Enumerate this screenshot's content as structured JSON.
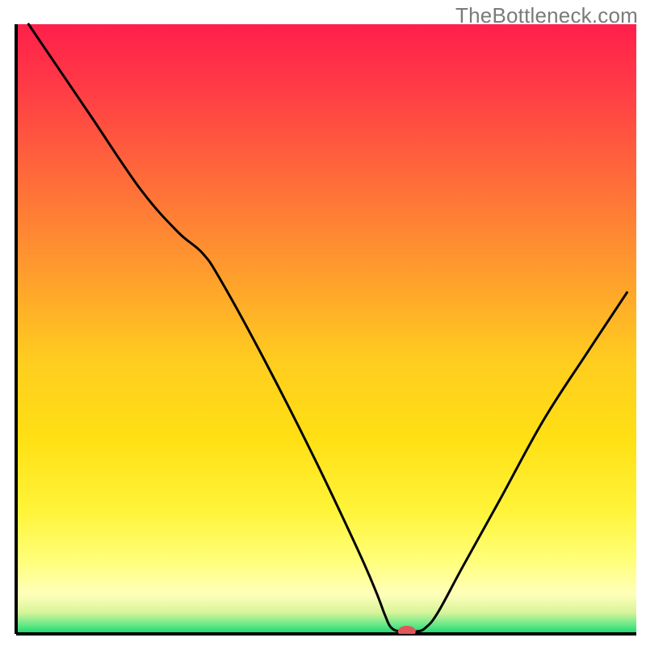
{
  "watermark": "TheBottleneck.com",
  "chart_data": {
    "type": "line",
    "title": "",
    "xlabel": "",
    "ylabel": "",
    "xlim": [
      0,
      100
    ],
    "ylim": [
      0,
      100
    ],
    "background_gradient": {
      "stops": [
        {
          "offset": 0.0,
          "color": "#ff1f4b"
        },
        {
          "offset": 0.1,
          "color": "#ff3a46"
        },
        {
          "offset": 0.25,
          "color": "#ff6a3a"
        },
        {
          "offset": 0.4,
          "color": "#ff9a2e"
        },
        {
          "offset": 0.55,
          "color": "#ffcc1f"
        },
        {
          "offset": 0.68,
          "color": "#ffe014"
        },
        {
          "offset": 0.8,
          "color": "#fff43a"
        },
        {
          "offset": 0.88,
          "color": "#ffff7a"
        },
        {
          "offset": 0.935,
          "color": "#ffffba"
        },
        {
          "offset": 0.965,
          "color": "#d8f49a"
        },
        {
          "offset": 0.985,
          "color": "#66e888"
        },
        {
          "offset": 1.0,
          "color": "#15d86a"
        }
      ]
    },
    "series": [
      {
        "name": "bottleneck-curve",
        "color": "#000000",
        "stroke_width": 3,
        "points": [
          {
            "x": 2.0,
            "y": 100.0
          },
          {
            "x": 6.0,
            "y": 94.0
          },
          {
            "x": 12.0,
            "y": 85.0
          },
          {
            "x": 20.0,
            "y": 73.0
          },
          {
            "x": 26.0,
            "y": 66.0
          },
          {
            "x": 30.0,
            "y": 62.5
          },
          {
            "x": 33.0,
            "y": 58.0
          },
          {
            "x": 40.0,
            "y": 45.0
          },
          {
            "x": 48.0,
            "y": 29.0
          },
          {
            "x": 55.0,
            "y": 14.0
          },
          {
            "x": 58.0,
            "y": 7.0
          },
          {
            "x": 59.5,
            "y": 3.0
          },
          {
            "x": 60.5,
            "y": 1.0
          },
          {
            "x": 62.0,
            "y": 0.4
          },
          {
            "x": 64.5,
            "y": 0.4
          },
          {
            "x": 66.0,
            "y": 1.0
          },
          {
            "x": 68.0,
            "y": 3.5
          },
          {
            "x": 72.0,
            "y": 11.0
          },
          {
            "x": 78.0,
            "y": 22.0
          },
          {
            "x": 85.0,
            "y": 35.0
          },
          {
            "x": 92.0,
            "y": 46.0
          },
          {
            "x": 98.5,
            "y": 56.0
          }
        ]
      }
    ],
    "marker": {
      "name": "optimal-point",
      "x": 63.0,
      "y": 0.4,
      "color": "#e0565a",
      "rx": 11,
      "ry": 7
    },
    "axes": {
      "color": "#000000",
      "width": 4
    }
  }
}
